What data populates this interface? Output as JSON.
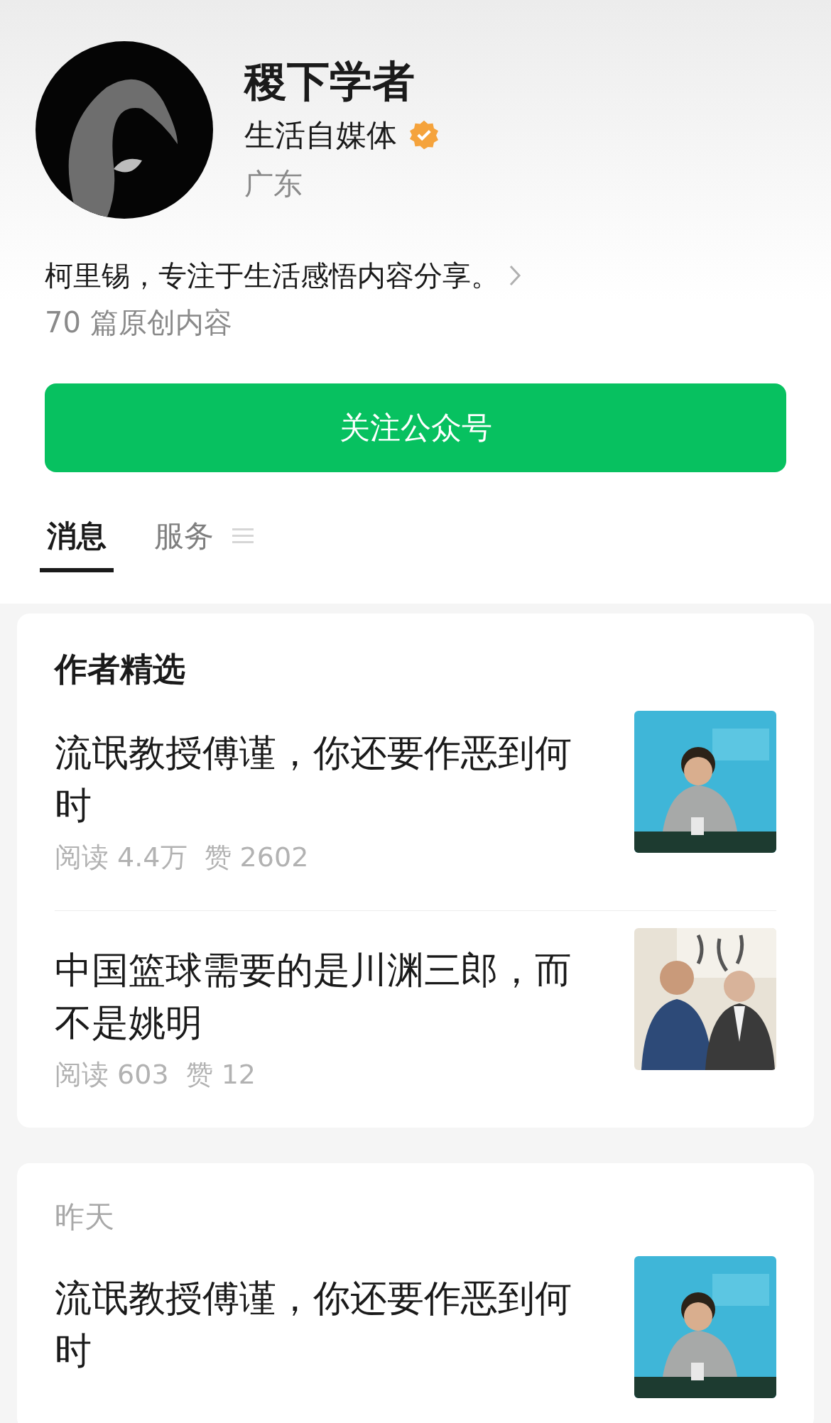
{
  "profile": {
    "name": "稷下学者",
    "category": "生活自媒体",
    "verified": true,
    "region": "广东",
    "bio": "柯里锡，专注于生活感悟内容分享。",
    "original_count": "70 篇原创内容"
  },
  "follow_button": "关注公众号",
  "tabs": [
    {
      "label": "消息",
      "selected": true,
      "menu": false
    },
    {
      "label": "服务",
      "selected": false,
      "menu": true
    }
  ],
  "sections": [
    {
      "heading": "作者精选",
      "kind": "featured",
      "articles": [
        {
          "title": "流氓教授傅谨，你还要作恶到何时",
          "reads": "阅读 4.4万",
          "likes": "赞 2602"
        },
        {
          "title": "中国篮球需要的是川渊三郎，而不是姚明",
          "reads": "阅读 603",
          "likes": "赞 12"
        }
      ]
    },
    {
      "heading": "昨天",
      "kind": "date",
      "articles": [
        {
          "title": "流氓教授傅谨，你还要作恶到何时"
        }
      ]
    }
  ]
}
